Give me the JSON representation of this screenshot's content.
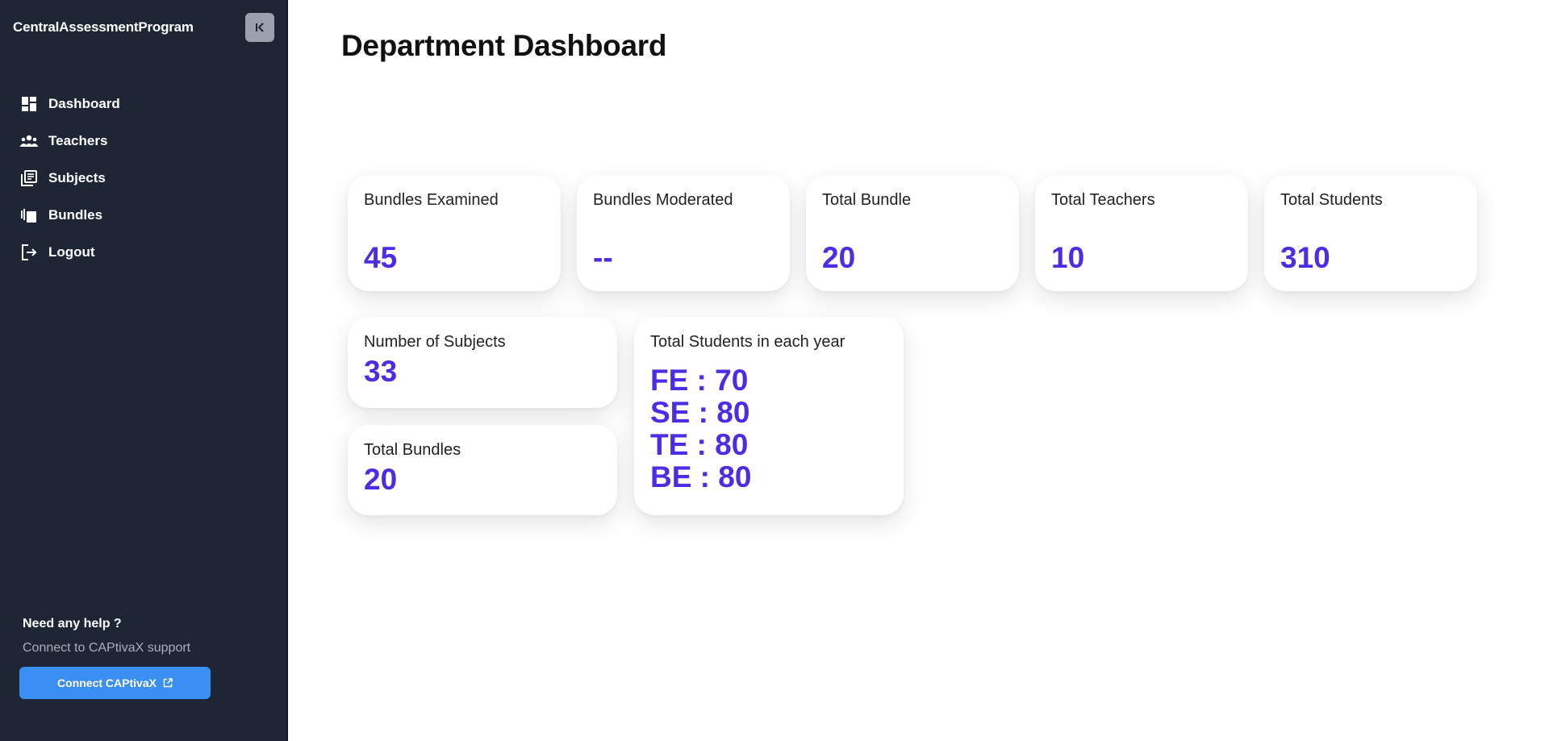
{
  "sidebar": {
    "brand": "CentralAssessmentProgram",
    "nav": [
      {
        "label": "Dashboard",
        "icon": "dashboard-icon"
      },
      {
        "label": "Teachers",
        "icon": "people-icon"
      },
      {
        "label": "Subjects",
        "icon": "library-books-icon"
      },
      {
        "label": "Bundles",
        "icon": "copies-icon"
      },
      {
        "label": "Logout",
        "icon": "logout-icon"
      }
    ],
    "help": {
      "title": "Need any help ?",
      "subtitle": "Connect to CAPtivaX support",
      "button_label": "Connect CAPtivaX"
    }
  },
  "main": {
    "title": "Department Dashboard",
    "stats": [
      {
        "label": "Bundles Examined",
        "value": "45"
      },
      {
        "label": "Bundles Moderated",
        "value": "--"
      },
      {
        "label": "Total Bundle",
        "value": "20"
      },
      {
        "label": "Total Teachers",
        "value": "10"
      },
      {
        "label": "Total Students",
        "value": "310"
      }
    ],
    "subjects_card": {
      "label": "Number of Subjects",
      "value": "33"
    },
    "bundles_card": {
      "label": "Total Bundles",
      "value": "20"
    },
    "years_card": {
      "label": "Total Students in each year",
      "lines": [
        "FE : 70",
        "SE : 80",
        "TE : 80",
        "BE : 80"
      ]
    }
  },
  "colors": {
    "sidebar_bg": "#1e2535",
    "accent_value": "#4a2de4",
    "button_bg": "#3b8ff2"
  }
}
